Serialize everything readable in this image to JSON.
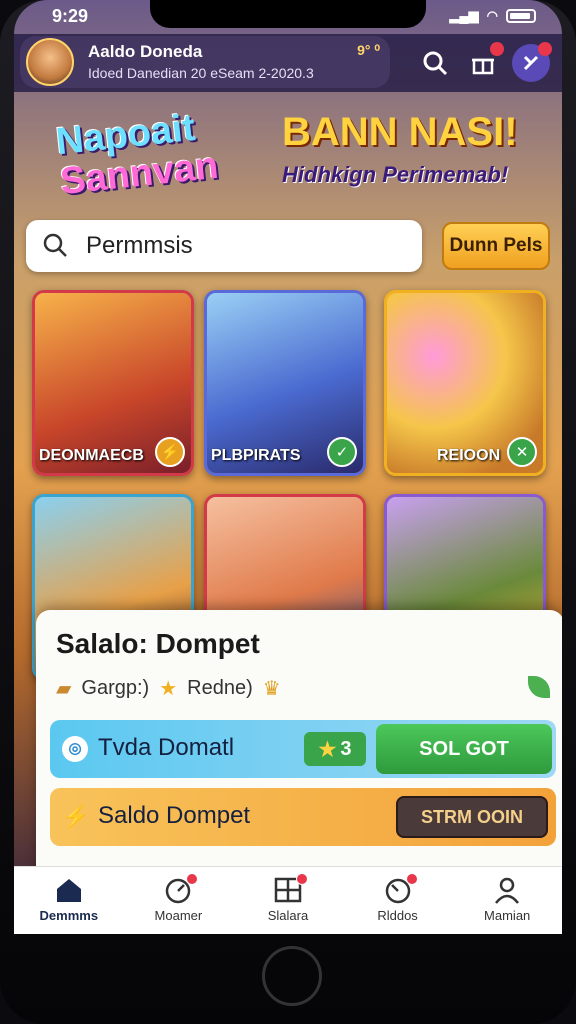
{
  "status": {
    "time": "9:29",
    "signal": "▂▄▆"
  },
  "header": {
    "name": "Aaldo Doneda",
    "subtitle": "Idoed Danedian 20 eSeam 2-2020.3",
    "coins": "9° ⁰",
    "search_btn_icon": "search-icon",
    "gift_icon": "gift-icon",
    "menu_icon": "menu-icon"
  },
  "hero": {
    "logo_line1": "Napoait",
    "logo_line2": "Sannvan",
    "title": "BANN NASI!",
    "subtitle": "Hidhkign Perimemab!"
  },
  "search": {
    "value": "Permmsis",
    "button": "Dunn Pels"
  },
  "games": [
    {
      "label": "DEONMAECB",
      "icon": "⚡"
    },
    {
      "label": "PLBPIRATS",
      "icon": "✓"
    },
    {
      "label": "REIOON",
      "icon": "✕"
    },
    {
      "label": "",
      "icon": ""
    },
    {
      "label": "",
      "icon": ""
    },
    {
      "label": "",
      "icon": ""
    }
  ],
  "sheet": {
    "title": "Salalo: Dompet",
    "meta_left": "Gargp:)",
    "meta_right": "Redne)",
    "row1_text": "Tvda Domatl",
    "row1_score": "3",
    "row1_button": "SOL GOT",
    "row2_text": "Saldo Dompet",
    "row2_button": "STRM OOIN"
  },
  "tabs": [
    {
      "label": "Demmms",
      "icon": "home-icon"
    },
    {
      "label": "Moamer",
      "icon": "speed-icon"
    },
    {
      "label": "Slalara",
      "icon": "grid-icon"
    },
    {
      "label": "Rlddos",
      "icon": "gauge-icon"
    },
    {
      "label": "Mamian",
      "icon": "user-icon"
    }
  ],
  "colors": {
    "accent": "#f0a020",
    "green": "#3aa44a",
    "cardBorder": "#d23a4a"
  }
}
